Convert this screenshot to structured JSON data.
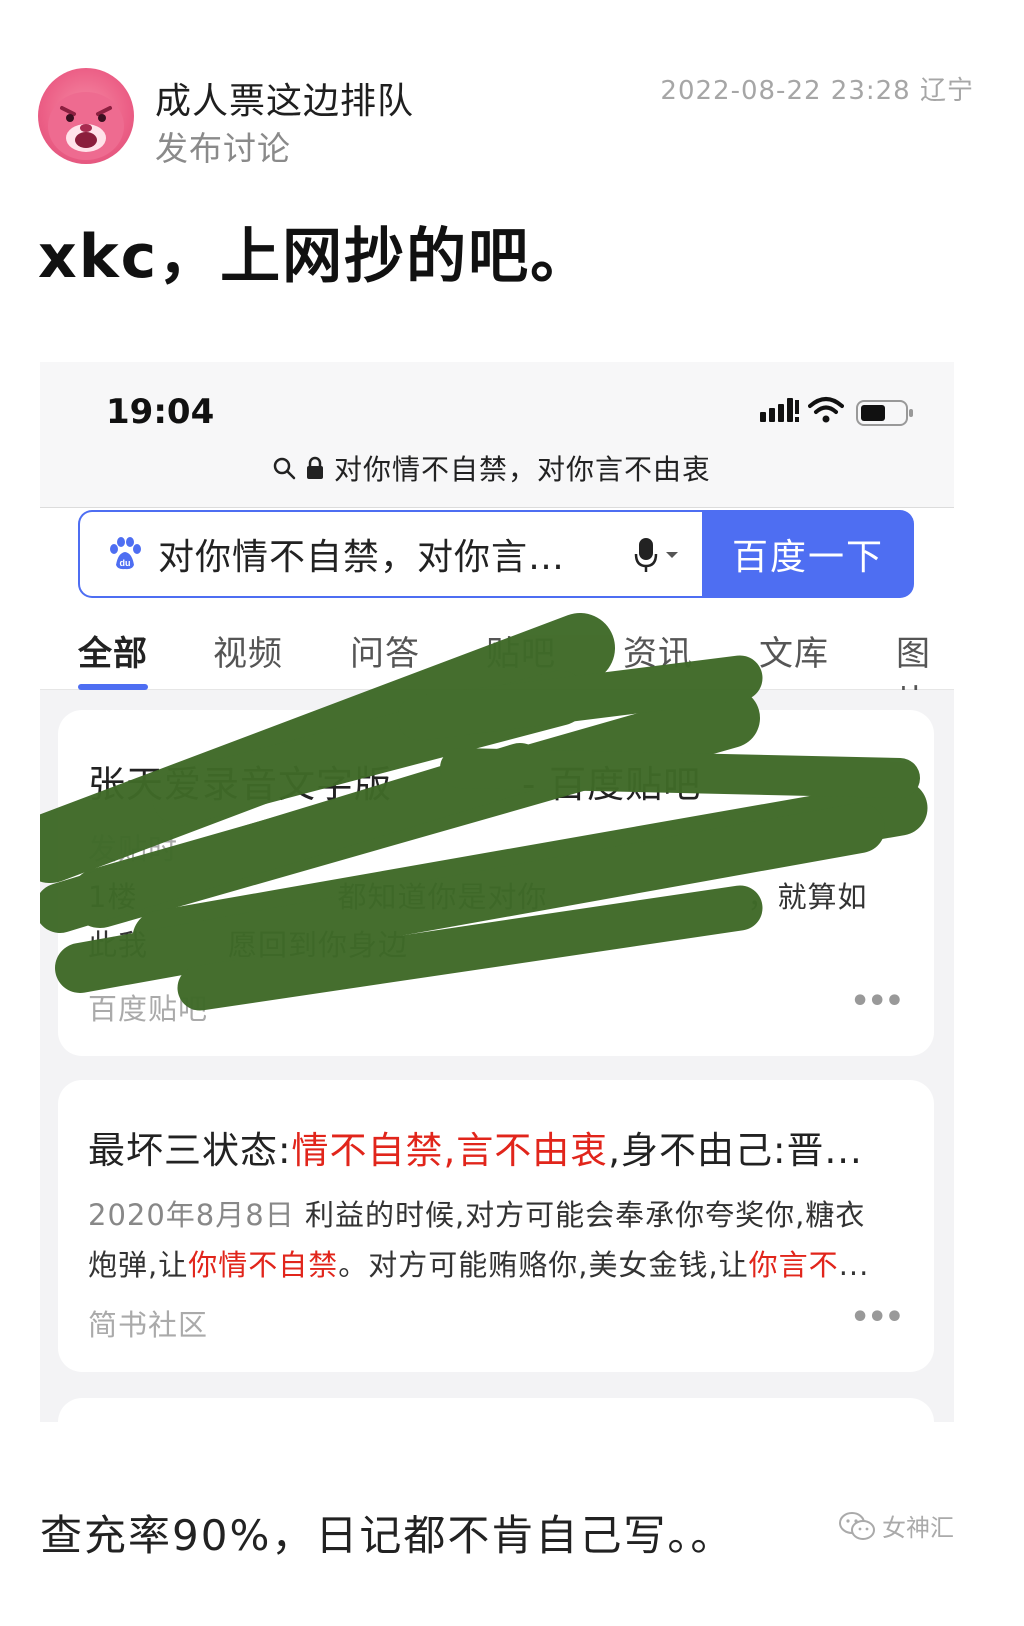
{
  "post": {
    "author": "成人票这边排队",
    "action": "发布讨论",
    "timestamp": "2022-08-22 23:28",
    "location": "辽宁",
    "headline": "xkc，上网抄的吧。"
  },
  "screenshot": {
    "status_time": "19:04",
    "url_text": "对你情不自禁，对你言不由衷",
    "search_query": "对你情不自禁，对你言…",
    "search_button": "百度一下",
    "tabs": [
      "全部",
      "视频",
      "问答",
      "贴吧",
      "资讯",
      "文库",
      "图片"
    ],
    "results": [
      {
        "title_a": "张天爱录音文字版",
        "title_b": "- 百度贴吧",
        "line1_a": "发贴时",
        "line2_a": "1楼",
        "line2_b": "都知道你是对你",
        "line2_c": "，就算如",
        "line3_a": "此我",
        "line3_b": "愿回到你身边",
        "source": "百度贴吧"
      },
      {
        "title_plain": "最坏三状态:",
        "title_red": "情不自禁,言不由衷",
        "title_rest": ",身不由己:晋...",
        "date": "2020年8月8日",
        "line1": "利益的时候,对方可能会奉承你夸奖你,糖衣",
        "line2_a": "炮弹,让",
        "line2_red1": "你情不自禁",
        "line2_b": "。对方可能贿赂你,美女金钱,让",
        "line2_red2": "你言不",
        "line2_c": "...",
        "source": "简书社区"
      }
    ]
  },
  "footer": {
    "text": "查充率90%，日记都不肯自己写。。",
    "watermark": "女神汇"
  },
  "colors": {
    "baidu_blue": "#4e6ef2",
    "highlight_red": "#e1251b",
    "scribble_green": "#3f6a28",
    "avatar_pink": "#ec5f86"
  },
  "icons": [
    "avatar",
    "search-icon",
    "lock-icon",
    "signal-icon",
    "wifi-icon",
    "battery-icon",
    "baidu-paw-icon",
    "microphone-icon",
    "chevron-down-icon",
    "more-icon",
    "wechat-icon"
  ]
}
